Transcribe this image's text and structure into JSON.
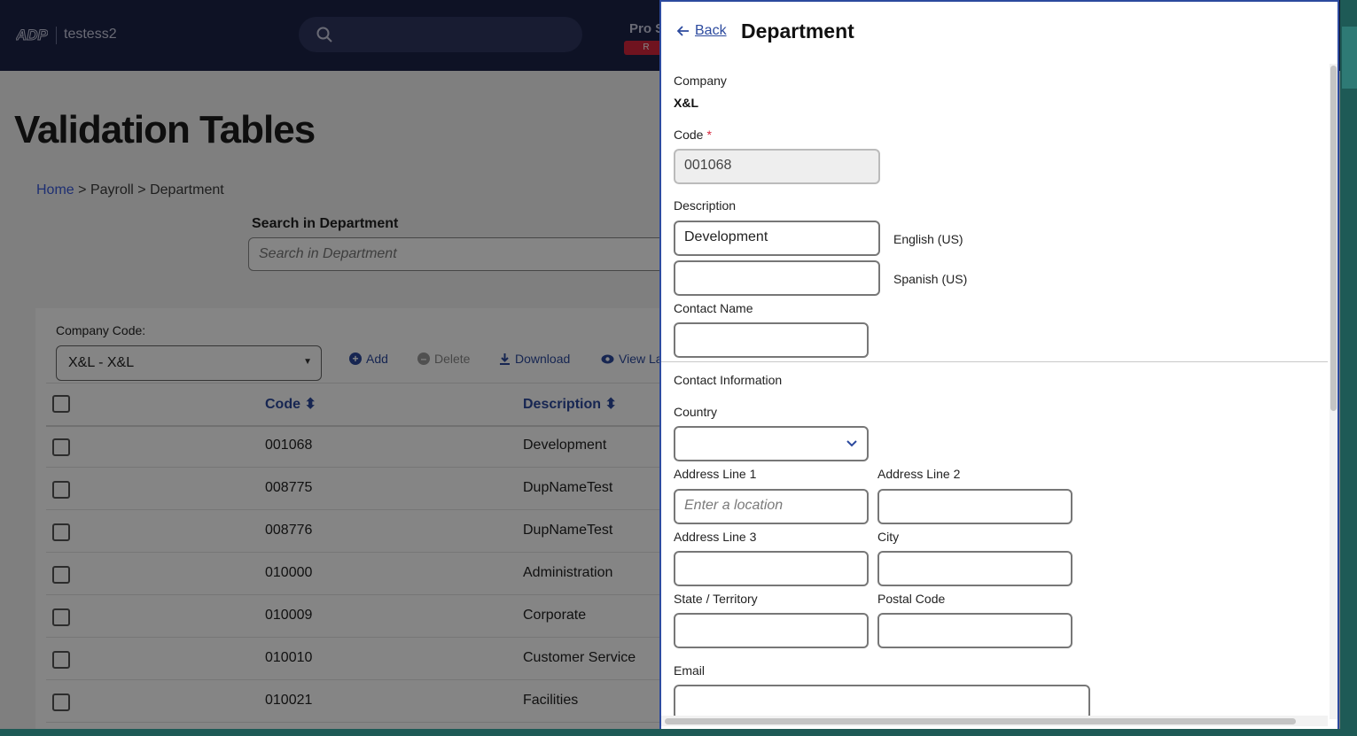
{
  "header": {
    "app_name": "testess2",
    "pro_label": "Pro S",
    "pro_badge": "R"
  },
  "page": {
    "title": "Validation Tables"
  },
  "breadcrumb": {
    "home": "Home",
    "sep1": ">",
    "payroll": "Payroll",
    "sep2": ">",
    "current": "Department"
  },
  "search": {
    "label": "Search in Department",
    "placeholder": "Search in Department"
  },
  "company": {
    "label": "Company Code:",
    "selected": "X&L - X&L"
  },
  "toolbar": {
    "add": "Add",
    "delete": "Delete",
    "download": "Download",
    "view": "View La"
  },
  "table": {
    "headers": {
      "code": "Code",
      "description": "Description"
    },
    "rows": [
      {
        "code": "001068",
        "description": "Development"
      },
      {
        "code": "008775",
        "description": "DupNameTest"
      },
      {
        "code": "008776",
        "description": "DupNameTest"
      },
      {
        "code": "010000",
        "description": "Administration"
      },
      {
        "code": "010009",
        "description": "Corporate"
      },
      {
        "code": "010010",
        "description": "Customer Service"
      },
      {
        "code": "010021",
        "description": "Facilities"
      }
    ]
  },
  "panel": {
    "back": "Back",
    "title": "Department",
    "company_label": "Company",
    "company_value": "X&L",
    "code_label": "Code",
    "required_mark": "*",
    "code_value": "001068",
    "description_label": "Description",
    "desc_en_value": "Development",
    "desc_en_lang": "English (US)",
    "desc_es_value": "",
    "desc_es_lang": "Spanish (US)",
    "contact_name_label": "Contact Name",
    "contact_info_label": "Contact Information",
    "country_label": "Country",
    "addr1_label": "Address Line 1",
    "addr1_placeholder": "Enter a location",
    "addr2_label": "Address Line 2",
    "addr3_label": "Address Line 3",
    "city_label": "City",
    "state_label": "State / Territory",
    "postal_label": "Postal Code",
    "email_label": "Email"
  },
  "colors": {
    "header_bg": "#1c2447",
    "accent": "#2c4a9e",
    "required": "#d7263d"
  }
}
